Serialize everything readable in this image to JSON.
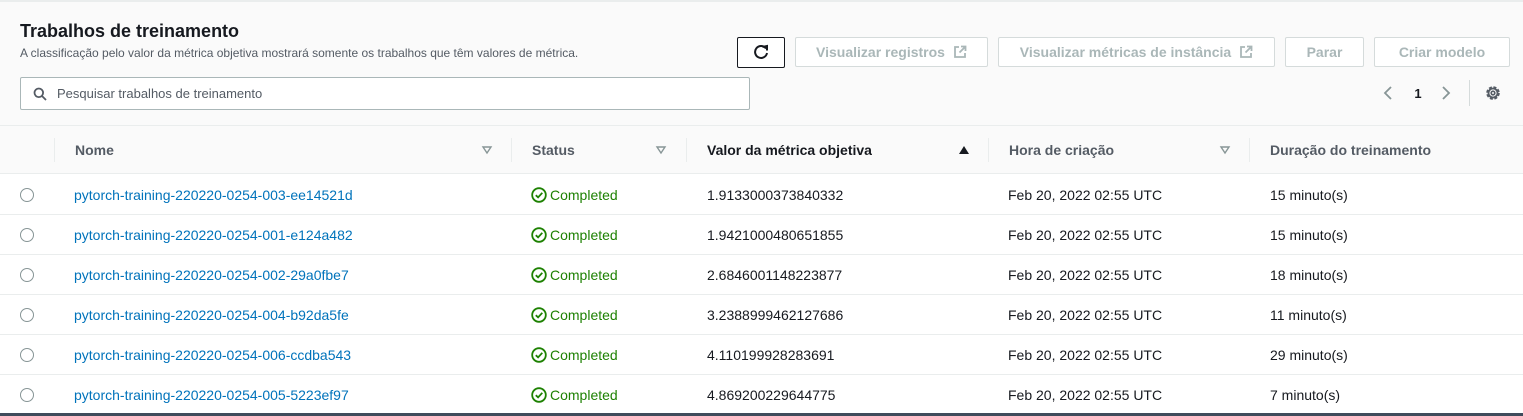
{
  "header": {
    "title": "Trabalhos de treinamento",
    "subtitle": "A classificação pelo valor da métrica objetiva mostrará somente os trabalhos que têm valores de métrica."
  },
  "toolbar": {
    "refresh_icon": "refresh-icon",
    "logs_label": "Visualizar registros",
    "metrics_label": "Visualizar métricas de instância",
    "stop_label": "Parar",
    "create_label": "Criar modelo",
    "external_icon": "external-link-icon"
  },
  "search": {
    "placeholder": "Pesquisar trabalhos de treinamento",
    "value": ""
  },
  "pagination": {
    "current_page": "1"
  },
  "table": {
    "columns": [
      "Nome",
      "Status",
      "Valor da métrica objetiva",
      "Hora de criação",
      "Duração do treinamento"
    ],
    "sorted_column": "Valor da métrica objetiva",
    "sort_direction": "ascending",
    "rows": [
      {
        "name": "pytorch-training-220220-0254-003-ee14521d",
        "status": "Completed",
        "metric": "1.9133000373840332",
        "created": "Feb 20, 2022 02:55 UTC",
        "duration": "15 minuto(s)"
      },
      {
        "name": "pytorch-training-220220-0254-001-e124a482",
        "status": "Completed",
        "metric": "1.9421000480651855",
        "created": "Feb 20, 2022 02:55 UTC",
        "duration": "15 minuto(s)"
      },
      {
        "name": "pytorch-training-220220-0254-002-29a0fbe7",
        "status": "Completed",
        "metric": "2.6846001148223877",
        "created": "Feb 20, 2022 02:55 UTC",
        "duration": "18 minuto(s)"
      },
      {
        "name": "pytorch-training-220220-0254-004-b92da5fe",
        "status": "Completed",
        "metric": "3.2388999462127686",
        "created": "Feb 20, 2022 02:55 UTC",
        "duration": "11 minuto(s)"
      },
      {
        "name": "pytorch-training-220220-0254-006-ccdba543",
        "status": "Completed",
        "metric": "4.110199928283691",
        "created": "Feb 20, 2022 02:55 UTC",
        "duration": "29 minuto(s)"
      },
      {
        "name": "pytorch-training-220220-0254-005-5223ef97",
        "status": "Completed",
        "metric": "4.869200229644775",
        "created": "Feb 20, 2022 02:55 UTC",
        "duration": "7 minuto(s)"
      }
    ]
  },
  "colors": {
    "link": "#0073bb",
    "status_success": "#1d8102",
    "disabled_text": "#aab7b8",
    "header_bg": "#fafafa"
  }
}
